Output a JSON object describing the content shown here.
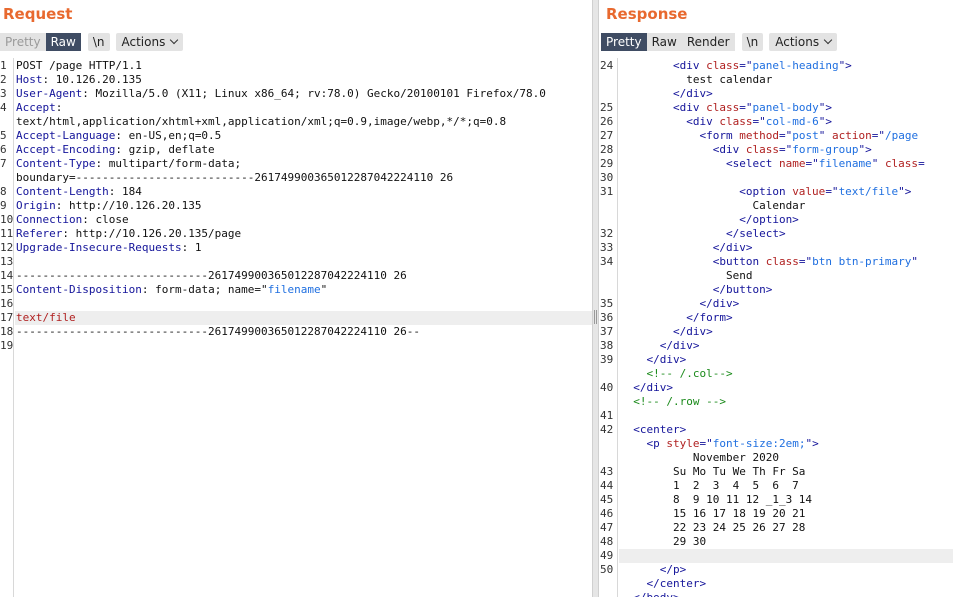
{
  "request": {
    "title": "Request",
    "toolbar": {
      "pretty": "Pretty",
      "raw": "Raw",
      "newline": "\\n",
      "actions": "Actions"
    },
    "lines": [
      {
        "n": "1",
        "segs": [
          {
            "t": "POST /page HTTP/1.1",
            "c": ""
          }
        ]
      },
      {
        "n": "2",
        "segs": [
          {
            "t": "Host",
            "c": "k"
          },
          {
            "t": ": 10.126.20.135",
            "c": ""
          }
        ]
      },
      {
        "n": "3",
        "segs": [
          {
            "t": "User-Agent",
            "c": "k"
          },
          {
            "t": ": Mozilla/5.0 (X11; Linux x86_64; rv:78.0) Gecko/20100101 Firefox/78.0",
            "c": ""
          }
        ]
      },
      {
        "n": "4",
        "segs": [
          {
            "t": "Accept",
            "c": "k"
          },
          {
            "t": ":",
            "c": ""
          }
        ]
      },
      {
        "n": "",
        "segs": [
          {
            "t": "text/html,application/xhtml+xml,application/xml;q=0.9,image/webp,*/*;q=0.8",
            "c": ""
          }
        ]
      },
      {
        "n": "5",
        "segs": [
          {
            "t": "Accept-Language",
            "c": "k"
          },
          {
            "t": ": en-US,en;q=0.5",
            "c": ""
          }
        ]
      },
      {
        "n": "6",
        "segs": [
          {
            "t": "Accept-Encoding",
            "c": "k"
          },
          {
            "t": ": gzip, deflate",
            "c": ""
          }
        ]
      },
      {
        "n": "7",
        "segs": [
          {
            "t": "Content-Type",
            "c": "k"
          },
          {
            "t": ": multipart/form-data;",
            "c": ""
          }
        ]
      },
      {
        "n": "",
        "segs": [
          {
            "t": "boundary=---------------------------261749900365012287042224110 26",
            "c": ""
          }
        ]
      },
      {
        "n": "8",
        "segs": [
          {
            "t": "Content-Length",
            "c": "k"
          },
          {
            "t": ": 184",
            "c": ""
          }
        ]
      },
      {
        "n": "9",
        "segs": [
          {
            "t": "Origin",
            "c": "k"
          },
          {
            "t": ": http://10.126.20.135",
            "c": ""
          }
        ]
      },
      {
        "n": "10",
        "segs": [
          {
            "t": "Connection",
            "c": "k"
          },
          {
            "t": ": close",
            "c": ""
          }
        ]
      },
      {
        "n": "11",
        "segs": [
          {
            "t": "Referer",
            "c": "k"
          },
          {
            "t": ": http://10.126.20.135/page",
            "c": ""
          }
        ]
      },
      {
        "n": "12",
        "segs": [
          {
            "t": "Upgrade-Insecure-Requests",
            "c": "k"
          },
          {
            "t": ": 1",
            "c": ""
          }
        ]
      },
      {
        "n": "13",
        "segs": []
      },
      {
        "n": "14",
        "segs": [
          {
            "t": "-----------------------------261749900365012287042224110 26",
            "c": ""
          }
        ]
      },
      {
        "n": "15",
        "segs": [
          {
            "t": "Content-Disposition",
            "c": "k"
          },
          {
            "t": ": form-data; name=\"",
            "c": ""
          },
          {
            "t": "filename",
            "c": "s"
          },
          {
            "t": "\"",
            "c": ""
          }
        ]
      },
      {
        "n": "16",
        "segs": []
      },
      {
        "n": "17",
        "segs": [
          {
            "t": "text/file",
            "c": "r"
          }
        ],
        "hl": true
      },
      {
        "n": "18",
        "segs": [
          {
            "t": "-----------------------------261749900365012287042224110 26--",
            "c": ""
          }
        ]
      },
      {
        "n": "19",
        "segs": []
      }
    ]
  },
  "response": {
    "title": "Response",
    "toolbar": {
      "pretty": "Pretty",
      "raw": "Raw",
      "render": "Render",
      "newline": "\\n",
      "actions": "Actions"
    },
    "lines": [
      {
        "n": "24",
        "segs": [
          {
            "t": "        <div ",
            "c": "t"
          },
          {
            "t": "class",
            "c": "r"
          },
          {
            "t": "=\"",
            "c": "t"
          },
          {
            "t": "panel-heading",
            "c": "s"
          },
          {
            "t": "\">",
            "c": "t"
          }
        ]
      },
      {
        "n": "",
        "segs": [
          {
            "t": "          test calendar",
            "c": ""
          }
        ]
      },
      {
        "n": "",
        "segs": [
          {
            "t": "        </div>",
            "c": "t"
          }
        ]
      },
      {
        "n": "25",
        "segs": [
          {
            "t": "        <div ",
            "c": "t"
          },
          {
            "t": "class",
            "c": "r"
          },
          {
            "t": "=\"",
            "c": "t"
          },
          {
            "t": "panel-body",
            "c": "s"
          },
          {
            "t": "\">",
            "c": "t"
          }
        ]
      },
      {
        "n": "26",
        "segs": [
          {
            "t": "          <div ",
            "c": "t"
          },
          {
            "t": "class",
            "c": "r"
          },
          {
            "t": "=\"",
            "c": "t"
          },
          {
            "t": "col-md-6",
            "c": "s"
          },
          {
            "t": "\">",
            "c": "t"
          }
        ]
      },
      {
        "n": "27",
        "segs": [
          {
            "t": "            <form ",
            "c": "t"
          },
          {
            "t": "method",
            "c": "r"
          },
          {
            "t": "=\"",
            "c": "t"
          },
          {
            "t": "post",
            "c": "s"
          },
          {
            "t": "\" ",
            "c": "t"
          },
          {
            "t": "action",
            "c": "r"
          },
          {
            "t": "=\"",
            "c": "t"
          },
          {
            "t": "/page",
            "c": "s"
          }
        ]
      },
      {
        "n": "28",
        "segs": [
          {
            "t": "              <div ",
            "c": "t"
          },
          {
            "t": "class",
            "c": "r"
          },
          {
            "t": "=\"",
            "c": "t"
          },
          {
            "t": "form-group",
            "c": "s"
          },
          {
            "t": "\">",
            "c": "t"
          }
        ]
      },
      {
        "n": "29",
        "segs": [
          {
            "t": "                <select ",
            "c": "t"
          },
          {
            "t": "name",
            "c": "r"
          },
          {
            "t": "=\"",
            "c": "t"
          },
          {
            "t": "filename",
            "c": "s"
          },
          {
            "t": "\" ",
            "c": "t"
          },
          {
            "t": "class",
            "c": "r"
          },
          {
            "t": "=",
            "c": "t"
          }
        ]
      },
      {
        "n": "30",
        "segs": []
      },
      {
        "n": "31",
        "segs": [
          {
            "t": "                  <option ",
            "c": "t"
          },
          {
            "t": "value",
            "c": "r"
          },
          {
            "t": "=\"",
            "c": "t"
          },
          {
            "t": "text/file",
            "c": "s"
          },
          {
            "t": "\">",
            "c": "t"
          }
        ]
      },
      {
        "n": "",
        "segs": [
          {
            "t": "                    Calendar",
            "c": ""
          }
        ]
      },
      {
        "n": "",
        "segs": [
          {
            "t": "                  </option>",
            "c": "t"
          }
        ]
      },
      {
        "n": "32",
        "segs": [
          {
            "t": "                </select>",
            "c": "t"
          }
        ]
      },
      {
        "n": "33",
        "segs": [
          {
            "t": "              </div>",
            "c": "t"
          }
        ]
      },
      {
        "n": "34",
        "segs": [
          {
            "t": "              <button ",
            "c": "t"
          },
          {
            "t": "class",
            "c": "r"
          },
          {
            "t": "=\"",
            "c": "t"
          },
          {
            "t": "btn btn-primary",
            "c": "s"
          },
          {
            "t": "\"",
            "c": "t"
          }
        ]
      },
      {
        "n": "",
        "segs": [
          {
            "t": "                Send",
            "c": ""
          }
        ]
      },
      {
        "n": "",
        "segs": [
          {
            "t": "              </button>",
            "c": "t"
          }
        ]
      },
      {
        "n": "35",
        "segs": [
          {
            "t": "            </div>",
            "c": "t"
          }
        ]
      },
      {
        "n": "36",
        "segs": [
          {
            "t": "          </form>",
            "c": "t"
          }
        ]
      },
      {
        "n": "37",
        "segs": [
          {
            "t": "        </div>",
            "c": "t"
          }
        ]
      },
      {
        "n": "38",
        "segs": [
          {
            "t": "      </div>",
            "c": "t"
          }
        ]
      },
      {
        "n": "39",
        "segs": [
          {
            "t": "    </div>",
            "c": "t"
          }
        ]
      },
      {
        "n": "",
        "segs": [
          {
            "t": "    <!-- /.col-->",
            "c": "c"
          }
        ]
      },
      {
        "n": "40",
        "segs": [
          {
            "t": "  </div>",
            "c": "t"
          }
        ]
      },
      {
        "n": "",
        "segs": [
          {
            "t": "  <!-- /.row -->",
            "c": "c"
          }
        ]
      },
      {
        "n": "41",
        "segs": []
      },
      {
        "n": "42",
        "segs": [
          {
            "t": "  <center>",
            "c": "t"
          }
        ]
      },
      {
        "n": "",
        "segs": [
          {
            "t": "    <p ",
            "c": "t"
          },
          {
            "t": "style",
            "c": "r"
          },
          {
            "t": "=\"",
            "c": "t"
          },
          {
            "t": "font-size:2em;",
            "c": "s"
          },
          {
            "t": "\">",
            "c": "t"
          }
        ]
      },
      {
        "n": "",
        "segs": [
          {
            "t": "           November 2020",
            "c": ""
          }
        ]
      },
      {
        "n": "43",
        "segs": [
          {
            "t": "        Su Mo Tu We Th Fr Sa",
            "c": ""
          }
        ]
      },
      {
        "n": "44",
        "segs": [
          {
            "t": "        1  2  3  4  5  6  7",
            "c": ""
          }
        ]
      },
      {
        "n": "45",
        "segs": [
          {
            "t": "        8  9 10 11 12 _1_3 14",
            "c": ""
          }
        ]
      },
      {
        "n": "46",
        "segs": [
          {
            "t": "        15 16 17 18 19 20 21",
            "c": ""
          }
        ]
      },
      {
        "n": "47",
        "segs": [
          {
            "t": "        22 23 24 25 26 27 28",
            "c": ""
          }
        ]
      },
      {
        "n": "48",
        "segs": [
          {
            "t": "        29 30",
            "c": ""
          }
        ]
      },
      {
        "n": "49",
        "segs": [],
        "hl": true
      },
      {
        "n": "50",
        "segs": [
          {
            "t": "      </p>",
            "c": "t"
          }
        ]
      },
      {
        "n": "",
        "segs": [
          {
            "t": "    </center>",
            "c": "t"
          }
        ]
      },
      {
        "n": "",
        "segs": [
          {
            "t": "  </body>",
            "c": "t"
          }
        ]
      }
    ]
  }
}
